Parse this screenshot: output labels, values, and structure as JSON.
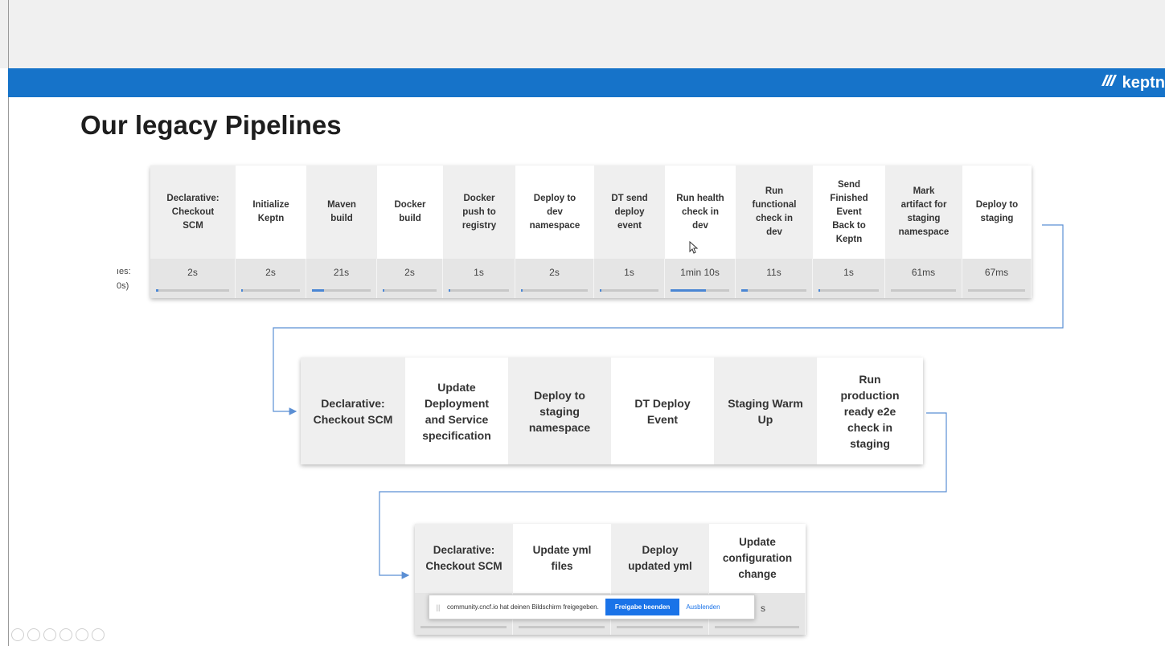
{
  "slide": {
    "title": "Our legacy Pipelines",
    "brand": "keptn",
    "left_label_line1": "ıes:",
    "left_label_line2": "0s)"
  },
  "pipeline1": {
    "stages": [
      {
        "name": "Declarative:\nCheckout\nSCM",
        "time": "2s",
        "progress": 0.02
      },
      {
        "name": "Initialize\nKeptn",
        "time": "2s",
        "progress": 0.02
      },
      {
        "name": "Maven\nbuild",
        "time": "21s",
        "progress": 0.2
      },
      {
        "name": "Docker\nbuild",
        "time": "2s",
        "progress": 0.02
      },
      {
        "name": "Docker\npush to\nregistry",
        "time": "1s",
        "progress": 0.01
      },
      {
        "name": "Deploy to\ndev\nnamespace",
        "time": "2s",
        "progress": 0.02
      },
      {
        "name": "DT send\ndeploy\nevent",
        "time": "1s",
        "progress": 0.01
      },
      {
        "name": "Run health\ncheck in\ndev",
        "time": "1min 10s",
        "progress": 0.6
      },
      {
        "name": "Run\nfunctional\ncheck in\ndev",
        "time": "11s",
        "progress": 0.1
      },
      {
        "name": "Send\nFinished\nEvent\nBack to\nKeptn",
        "time": "1s",
        "progress": 0.01
      },
      {
        "name": "Mark\nartifact for\nstaging\nnamespace",
        "time": "61ms",
        "progress": 0.0
      },
      {
        "name": "Deploy to\nstaging",
        "time": "67ms",
        "progress": 0.0
      }
    ]
  },
  "pipeline2": {
    "stages": [
      {
        "name": "Declarative:\nCheckout SCM"
      },
      {
        "name": "Update\nDeployment\nand Service\nspecification"
      },
      {
        "name": "Deploy to\nstaging\nnamespace"
      },
      {
        "name": "DT Deploy\nEvent"
      },
      {
        "name": "Staging Warm\nUp"
      },
      {
        "name": "Run\nproduction\nready e2e\ncheck in\nstaging"
      }
    ]
  },
  "pipeline3": {
    "stages": [
      {
        "name": "Declarative:\nCheckout SCM"
      },
      {
        "name": "Update yml\nfiles"
      },
      {
        "name": "Deploy\nupdated yml"
      },
      {
        "name": "Update\nconfiguration\nchange"
      }
    ],
    "trailing_time_fragment": "s"
  },
  "share_banner": {
    "message": "community.cncf.io hat deinen Bildschirm freigegeben.",
    "stop_label": "Freigabe beenden",
    "hide_label": "Ausblenden"
  },
  "colors": {
    "header_blue": "#1673c9",
    "connector": "#5b8fd4",
    "progress_fill": "#4a86d4",
    "share_button": "#1a73e8"
  },
  "icons": [
    "keptn-logo-icon",
    "cursor-icon",
    "grip-icon",
    "prev-slide-icon",
    "next-slide-icon",
    "pen-icon",
    "slides-icon",
    "zoom-icon",
    "more-icon"
  ]
}
